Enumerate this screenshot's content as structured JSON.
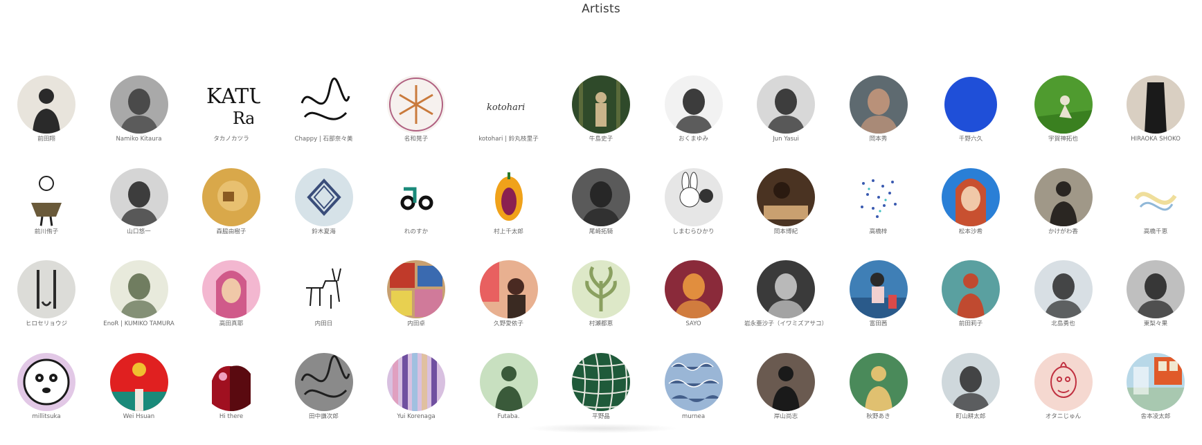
{
  "page": {
    "title": "Artists"
  },
  "artists": [
    {
      "name": "前田翔",
      "bg": "#e8e4dc",
      "fg": "#2a2a2a",
      "motif": "person"
    },
    {
      "name": "Namiko Kitaura",
      "bg": "#a9a9a9",
      "fg": "#3a3a3a",
      "motif": "face"
    },
    {
      "name": "タカノカツラ",
      "bg": "#ffffff",
      "fg": "#111111",
      "motif": "letters"
    },
    {
      "name": "Chappy | 石部奈々美",
      "bg": "#ffffff",
      "fg": "#111111",
      "motif": "scribble"
    },
    {
      "name": "名和晃子",
      "bg": "#f6f1ee",
      "fg": "#c97a3c",
      "motif": "snowflake"
    },
    {
      "name": "kotohari | 鈴丸枝里子",
      "bg": "#ffffff",
      "fg": "#333333",
      "motif": "script"
    },
    {
      "name": "牛島史子",
      "bg": "#2f4a2a",
      "fg": "#c9b48a",
      "motif": "forest"
    },
    {
      "name": "おくまゆみ",
      "bg": "#f2f2f2",
      "fg": "#1c1c1c",
      "motif": "face"
    },
    {
      "name": "Jun Yasui",
      "bg": "#d8d8d8",
      "fg": "#222222",
      "motif": "face"
    },
    {
      "name": "岡本秀",
      "bg": "#5e6a70",
      "fg": "#c9987a",
      "motif": "face"
    },
    {
      "name": "千野六久",
      "bg": "#ffffff",
      "fg": "#1f4fd8",
      "motif": "blueblob"
    },
    {
      "name": "宇賀神拓也",
      "bg": "#4f9b2f",
      "fg": "#e8e2d0",
      "motif": "field"
    },
    {
      "name": "HIRAOKA SHOKO",
      "bg": "#d9cfc2",
      "fg": "#1a1a1a",
      "motif": "dress"
    },
    {
      "name": "前川侑子",
      "bg": "#ffffff",
      "fg": "#222222",
      "motif": "figure"
    },
    {
      "name": "山口悠一",
      "bg": "#d5d5d5",
      "fg": "#222222",
      "motif": "face"
    },
    {
      "name": "森脇由樹子",
      "bg": "#d9a84a",
      "fg": "#8a5a22",
      "motif": "abstract"
    },
    {
      "name": "鈴木夏海",
      "bg": "#d6e2e8",
      "fg": "#3a4d7a",
      "motif": "diamond"
    },
    {
      "name": "れのすか",
      "bg": "#ffffff",
      "fg": "#111111",
      "motif": "logo"
    },
    {
      "name": "村上千太郎",
      "bg": "#ffffff",
      "fg": "#f0a21a",
      "motif": "papaya"
    },
    {
      "name": "尾崎拓騎",
      "bg": "#5a5a5a",
      "fg": "#1f1f1f",
      "motif": "face"
    },
    {
      "name": "しまむらひかり",
      "bg": "#e6e6e6",
      "fg": "#333333",
      "motif": "rabbit"
    },
    {
      "name": "岡本博紀",
      "bg": "#4a3322",
      "fg": "#c9a070",
      "motif": "desk"
    },
    {
      "name": "高橋梓",
      "bg": "#ffffff",
      "fg": "#3a5ab0",
      "motif": "dots"
    },
    {
      "name": "松本沙希",
      "bg": "#2a7fd6",
      "fg": "#c85030",
      "motif": "portrait"
    },
    {
      "name": "かけがわ香",
      "bg": "#a09888",
      "fg": "#2a2622",
      "motif": "person"
    },
    {
      "name": "高橋千恵",
      "bg": "#ffffff",
      "fg": "#e8d070",
      "motif": "wisp"
    },
    {
      "name": "ヒロセリョウジ",
      "bg": "#dcdcd8",
      "fg": "#2a2a2a",
      "motif": "mask"
    },
    {
      "name": "EnoR | KUMIKO TAMURA",
      "bg": "#e8eadc",
      "fg": "#5a6a4a",
      "motif": "face"
    },
    {
      "name": "高田真耶",
      "bg": "#f3b7d0",
      "fg": "#d05a8a",
      "motif": "portrait"
    },
    {
      "name": "内田日",
      "bg": "#ffffff",
      "fg": "#1a1a1a",
      "motif": "goat"
    },
    {
      "name": "内田卓",
      "bg": "#c8a070",
      "fg": "#c03a2a",
      "motif": "collage"
    },
    {
      "name": "久野愛依子",
      "bg": "#e8b090",
      "fg": "#4a2a22",
      "motif": "room"
    },
    {
      "name": "村瀬都恵",
      "bg": "#dde8c8",
      "fg": "#8aa060",
      "motif": "plant"
    },
    {
      "name": "SAYO",
      "bg": "#8a2a3a",
      "fg": "#f0a040",
      "motif": "face"
    },
    {
      "name": "岩永亜沙子（イワミズアサコ）",
      "bg": "#3a3a3a",
      "fg": "#d0d0d0",
      "motif": "face"
    },
    {
      "name": "富田茜",
      "bg": "#3f7fb6",
      "fg": "#d94a4a",
      "motif": "seats"
    },
    {
      "name": "前田莉子",
      "bg": "#5aa0a0",
      "fg": "#c04a30",
      "motif": "person"
    },
    {
      "name": "北島勇也",
      "bg": "#d8dfe4",
      "fg": "#2a2a2a",
      "motif": "face"
    },
    {
      "name": "東梨々果",
      "bg": "#bfbfbf",
      "fg": "#1f1f1f",
      "motif": "face"
    },
    {
      "name": "millitsuka",
      "bg": "#e2c8e6",
      "fg": "#1a1a1a",
      "motif": "lemur"
    },
    {
      "name": "Wei Hsuan",
      "bg": "#e02020",
      "fg": "#f0c030",
      "motif": "sun"
    },
    {
      "name": "Hi there",
      "bg": "#ffffff",
      "fg": "#a01020",
      "motif": "silhouette"
    },
    {
      "name": "田中謙次郎",
      "bg": "#8a8a8a",
      "fg": "#1f1f1f",
      "motif": "scribble"
    },
    {
      "name": "Yui Korenaga",
      "bg": "#d8c0e0",
      "fg": "#7050a0",
      "motif": "stripes"
    },
    {
      "name": "Futaba.",
      "bg": "#c8e0c0",
      "fg": "#3a5a3a",
      "motif": "person"
    },
    {
      "name": "平野晶",
      "bg": "#1f5a3a",
      "fg": "#e8e8e0",
      "motif": "net"
    },
    {
      "name": "murnea",
      "bg": "#9ab6d6",
      "fg": "#1f3a6a",
      "motif": "pattern"
    },
    {
      "name": "岸山尚志",
      "bg": "#6a5a50",
      "fg": "#1a1a1a",
      "motif": "person"
    },
    {
      "name": "秋野あき",
      "bg": "#4a8a5a",
      "fg": "#e0c070",
      "motif": "person"
    },
    {
      "name": "町山耕太郎",
      "bg": "#cfd8dc",
      "fg": "#2a2a2a",
      "motif": "face"
    },
    {
      "name": "オタニじゅん",
      "bg": "#f5d8d0",
      "fg": "#c03040",
      "motif": "drawing"
    },
    {
      "name": "舎本凌太郎",
      "bg": "#b8d8e8",
      "fg": "#e05a2a",
      "motif": "window"
    }
  ]
}
